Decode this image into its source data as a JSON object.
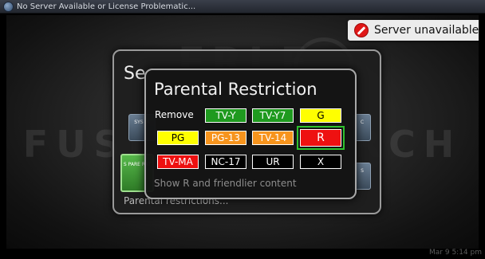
{
  "window": {
    "title": "No Server Available or License Problematic..."
  },
  "server_status": {
    "icon": "no-entry-icon",
    "text": "Server unavailable",
    "color": "#e01818"
  },
  "settings_panel": {
    "title": "Se",
    "tiles": [
      {
        "label": "SYS IN"
      },
      {
        "label": "S PARE RAT"
      },
      {
        "label": "C"
      },
      {
        "label": "S"
      }
    ],
    "footer": "Parental restrictions..."
  },
  "parental_dialog": {
    "title": "Parental Restriction",
    "remove_label": "Remove",
    "ratings": [
      {
        "label": "TV-Y",
        "bg": "#1f9a1f",
        "fg": "#ffffff",
        "selected": false
      },
      {
        "label": "TV-Y7",
        "bg": "#1f9a1f",
        "fg": "#ffffff",
        "selected": false
      },
      {
        "label": "G",
        "bg": "#ffff00",
        "fg": "#000000",
        "selected": false
      },
      {
        "label": "PG",
        "bg": "#ffff00",
        "fg": "#000000",
        "selected": false
      },
      {
        "label": "PG-13",
        "bg": "#f7941d",
        "fg": "#ffffff",
        "selected": false
      },
      {
        "label": "TV-14",
        "bg": "#f7941d",
        "fg": "#ffffff",
        "selected": false
      },
      {
        "label": "R",
        "bg": "#ee1111",
        "fg": "#ffffff",
        "selected": true
      },
      {
        "label": "TV-MA",
        "bg": "#ee1111",
        "fg": "#ffffff",
        "selected": false
      },
      {
        "label": "NC-17",
        "bg": "#000000",
        "fg": "#ffffff",
        "selected": false
      },
      {
        "label": "UR",
        "bg": "#000000",
        "fg": "#ffffff",
        "selected": false
      },
      {
        "label": "X",
        "bg": "#000000",
        "fg": "#ffffff",
        "selected": false
      }
    ],
    "hint": "Show R and friendlier content"
  },
  "status_bar": {
    "clock": "Mar 9  5:14 pm"
  }
}
